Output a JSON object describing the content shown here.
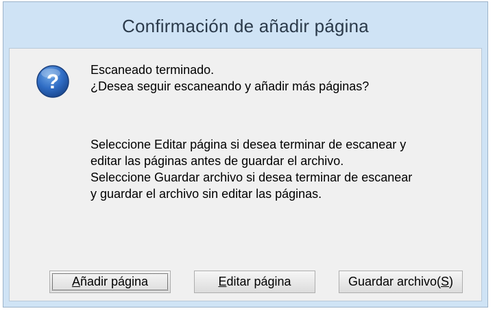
{
  "dialog": {
    "title": "Confirmación de añadir página",
    "icon": "question-icon",
    "message_line1": "Escaneado terminado.",
    "message_line2": "¿Desea seguir escaneando y añadir más páginas?",
    "info_line1": "Seleccione Editar página si desea terminar de escanear y",
    "info_line2": "editar las páginas antes de guardar el archivo.",
    "info_line3": "Seleccione Guardar archivo si desea terminar de escanear",
    "info_line4": "y guardar el archivo sin editar las páginas."
  },
  "buttons": {
    "add_page": {
      "pre": "",
      "mnemonic": "A",
      "post": "ñadir página"
    },
    "edit_page": {
      "pre": "",
      "mnemonic": "E",
      "post": "ditar página"
    },
    "save_file": {
      "pre": "Guardar archivo(",
      "mnemonic": "S",
      "post": ")"
    }
  }
}
